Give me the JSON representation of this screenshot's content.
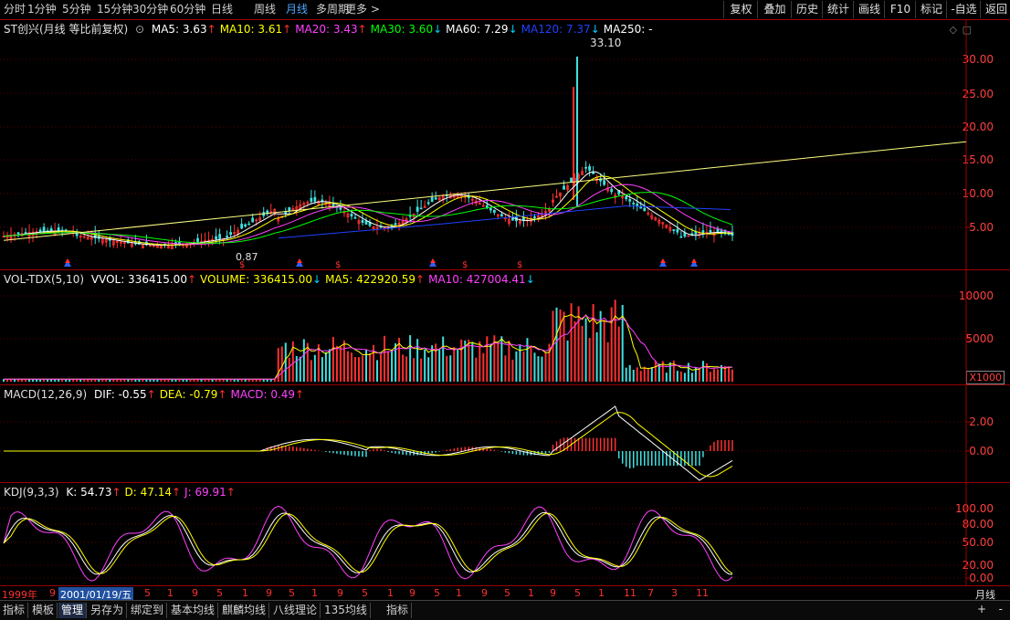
{
  "topbar": {
    "periods": [
      "分时",
      "1分钟",
      "5分钟",
      "15分钟",
      "30分钟",
      "60分钟",
      "日线",
      "周线",
      "月线",
      "多周期",
      "更多 >"
    ],
    "active_period": "月线",
    "right_buttons": [
      "复权",
      "叠加",
      "历史",
      "统计",
      "画线",
      "F10",
      "标记",
      "-自选",
      "返回"
    ]
  },
  "main": {
    "stock": "ST创兴(月线 等比前复权)",
    "ma": [
      {
        "label": "MA5: 3.63",
        "arrow": "↑",
        "color": "#ffffff"
      },
      {
        "label": "MA10: 3.61",
        "arrow": "↑",
        "color": "#ffff00"
      },
      {
        "label": "MA20: 3.43",
        "arrow": "↑",
        "color": "#ff40ff"
      },
      {
        "label": "MA30: 3.60",
        "arrow": "↓",
        "color": "#00ff00"
      },
      {
        "label": "MA60: 7.29",
        "arrow": "↓",
        "color": "#ffffff"
      },
      {
        "label": "MA120: 7.37",
        "arrow": "↓",
        "color": "#2040ff"
      },
      {
        "label": "MA250: -",
        "arrow": "",
        "color": "#ffffff"
      }
    ],
    "peak_label": "33.10",
    "low_label": "0.87",
    "yticks": [
      "30.00",
      "25.00",
      "20.00",
      "15.00",
      "10.00",
      "5.00"
    ]
  },
  "vol": {
    "title": "VOL-TDX(5,10)",
    "items": [
      {
        "label": "VVOL: 336415.00",
        "arrow": "↑",
        "color": "#ffffff"
      },
      {
        "label": "VOLUME: 336415.00",
        "arrow": "↓",
        "color": "#ffff00"
      },
      {
        "label": "MA5: 422920.59",
        "arrow": "↑",
        "color": "#ffff00"
      },
      {
        "label": "MA10: 427004.41",
        "arrow": "↓",
        "color": "#ff40ff"
      }
    ],
    "yticks": [
      "10000",
      "5000"
    ],
    "unit": "X1000"
  },
  "macd": {
    "title": "MACD(12,26,9)",
    "items": [
      {
        "label": "DIF: -0.55",
        "arrow": "↑",
        "color": "#ffffff"
      },
      {
        "label": "DEA: -0.79",
        "arrow": "↑",
        "color": "#ffff00"
      },
      {
        "label": "MACD: 0.49",
        "arrow": "↑",
        "color": "#ff40ff"
      }
    ],
    "yticks": [
      "2.00",
      "0.00"
    ]
  },
  "kdj": {
    "title": "KDJ(9,3,3)",
    "items": [
      {
        "label": "K: 54.73",
        "arrow": "↑",
        "color": "#ffffff"
      },
      {
        "label": "D: 47.14",
        "arrow": "↑",
        "color": "#ffff00"
      },
      {
        "label": "J: 69.91",
        "arrow": "↑",
        "color": "#ff40ff"
      }
    ],
    "yticks": [
      "100.00",
      "80.00",
      "50.00",
      "20.00",
      "0.00"
    ]
  },
  "datebar": {
    "start": "1999年",
    "cursor": "2001/01/19/五",
    "months": [
      "9",
      "5",
      "1",
      "9",
      "5",
      "1",
      "9",
      "5",
      "1",
      "9",
      "5",
      "1",
      "9",
      "5",
      "1",
      "9",
      "5",
      "1",
      "9",
      "5",
      "1",
      "11",
      "7",
      "3",
      "11"
    ],
    "period": "月线"
  },
  "tabs": [
    "指标",
    "模板",
    "管理",
    "另存为",
    "绑定到",
    "基本均线",
    "麒麟均线",
    "八线理论",
    "135均线",
    "指标"
  ],
  "selected_tab": "管理",
  "corner_buttons": [
    "+",
    "-"
  ]
}
